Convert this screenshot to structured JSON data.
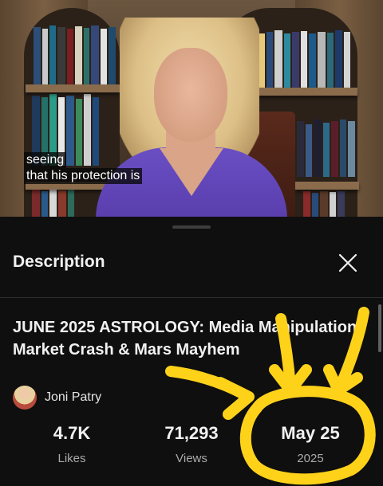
{
  "video": {
    "captions": [
      "seeing",
      "that his protection is"
    ]
  },
  "panel": {
    "title": "Description",
    "close_icon": "close-icon"
  },
  "details": {
    "title": "JUNE 2025 ASTROLOGY: Media Manipulation, Market Crash & Mars Mayhem",
    "channel_name": "Joni Patry",
    "stats": [
      {
        "value": "4.7K",
        "label": "Likes"
      },
      {
        "value": "71,293",
        "label": "Views"
      },
      {
        "value": "May 25",
        "label": "2025"
      }
    ]
  },
  "colors": {
    "background": "#0f0f0f",
    "annotation": "#ffd21a",
    "jacket": "#6a4fc4"
  }
}
